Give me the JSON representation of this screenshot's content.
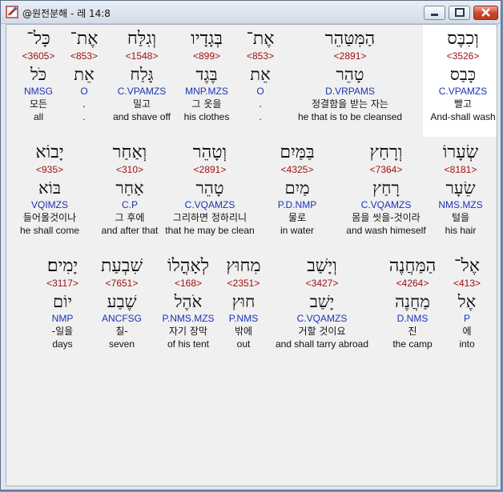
{
  "window": {
    "title": "@원전분해 - 레 14:8",
    "icon": "app-book-icon",
    "controls": [
      "minimize",
      "maximize",
      "close"
    ]
  },
  "colors": {
    "strong": "#a01010",
    "morph": "#1a33b8",
    "text": "#111111",
    "background": "#f0f0f0",
    "selected": "#ffffff"
  },
  "lines": [
    {
      "words": [
        {
          "heb": "וְכִבֶּס",
          "strong": "<3526>",
          "lemma": "כָּבַס",
          "morph": "C.VPAMZS",
          "kor": "빨고",
          "eng": "And-shall wash",
          "selected": true
        },
        {
          "heb": "הַמִּטַּהֵר",
          "strong": "<2891>",
          "lemma": "טָהֵר",
          "morph": "D.VRPAMS",
          "kor": "정결함을 받는 자는",
          "eng": "he that is to be cleansed"
        },
        {
          "heb": "אֶת־",
          "strong": "<853>",
          "lemma": "אֵת",
          "morph": "O",
          "kor": ".",
          "eng": "."
        },
        {
          "heb": "בְּגָדָיו",
          "strong": "<899>",
          "lemma": "בֶּגֶד",
          "morph": "MNP.MZS",
          "kor": "그 옷을",
          "eng": "his clothes"
        },
        {
          "heb": "וְגִלַּח",
          "strong": "<1548>",
          "lemma": "גָּלַח",
          "morph": "C.VPAMZS",
          "kor": "밀고",
          "eng": "and shave off"
        },
        {
          "heb": "אֶת־",
          "strong": "<853>",
          "lemma": "אֵת",
          "morph": "O",
          "kor": ".",
          "eng": "."
        },
        {
          "heb": "כָּל־",
          "strong": "<3605>",
          "lemma": "כֹּל",
          "morph": "NMSG",
          "kor": "모든",
          "eng": "all"
        }
      ]
    },
    {
      "words": [
        {
          "heb": "שְׂעָרוֹ",
          "strong": "<8181>",
          "lemma": "שֵׂעָר",
          "morph": "NMS.MZS",
          "kor": "털을",
          "eng": "his hair"
        },
        {
          "heb": "וְרָחַץ",
          "strong": "<7364>",
          "lemma": "רָחַץ",
          "morph": "C.VQAMZS",
          "kor": "몸을 씻을-것이라",
          "eng": "and wash himeself"
        },
        {
          "heb": "בַּמַּיִם",
          "strong": "<4325>",
          "lemma": "מַיִם",
          "morph": "P.D.NMP",
          "kor": "물로",
          "eng": "in water"
        },
        {
          "heb": "וְטָהֵר",
          "strong": "<2891>",
          "lemma": "טָהֵר",
          "morph": "C.VQAMZS",
          "kor": "그리하면 정하리니",
          "eng": "that he may be clean"
        },
        {
          "heb": "וְאַחַר",
          "strong": "<310>",
          "lemma": "אַחַר",
          "morph": "C.P",
          "kor": "그 후에",
          "eng": "and after that"
        },
        {
          "heb": "יָבוֹא",
          "strong": "<935>",
          "lemma": "בּוֹא",
          "morph": "VQIMZS",
          "kor": "들어올것이나",
          "eng": "he shall come"
        }
      ]
    },
    {
      "words": [
        {
          "heb": "אֶל־",
          "strong": "<413>",
          "lemma": "אֶל",
          "morph": "P",
          "kor": "에",
          "eng": "into"
        },
        {
          "heb": "הַמַּחֲנֶה",
          "strong": "<4264>",
          "lemma": "מַחֲנֶה",
          "morph": "D.NMS",
          "kor": "진",
          "eng": "the camp"
        },
        {
          "heb": "וְיָשַׁב",
          "strong": "<3427>",
          "lemma": "יָשַׁב",
          "morph": "C.VQAMZS",
          "kor": "거할 것이요",
          "eng": "and shall tarry abroad"
        },
        {
          "heb": "מִחוּץ",
          "strong": "<2351>",
          "lemma": "חוּץ",
          "morph": "P.NMS",
          "kor": "밖에",
          "eng": "out"
        },
        {
          "heb": "לְאָהֳלוֹ",
          "strong": "<168>",
          "lemma": "אֹהֶל",
          "morph": "P.NMS.MZS",
          "kor": "자기 장막",
          "eng": "of his tent"
        },
        {
          "heb": "שִׁבְעַת",
          "strong": "<7651>",
          "lemma": "שֶׁבַע",
          "morph": "ANCFSG",
          "kor": "칠-",
          "eng": "seven"
        },
        {
          "heb": "יָמִים׃",
          "strong": "<3117>",
          "lemma": "יוֹם",
          "morph": "NMP",
          "kor": "-일을",
          "eng": "days"
        }
      ]
    }
  ]
}
